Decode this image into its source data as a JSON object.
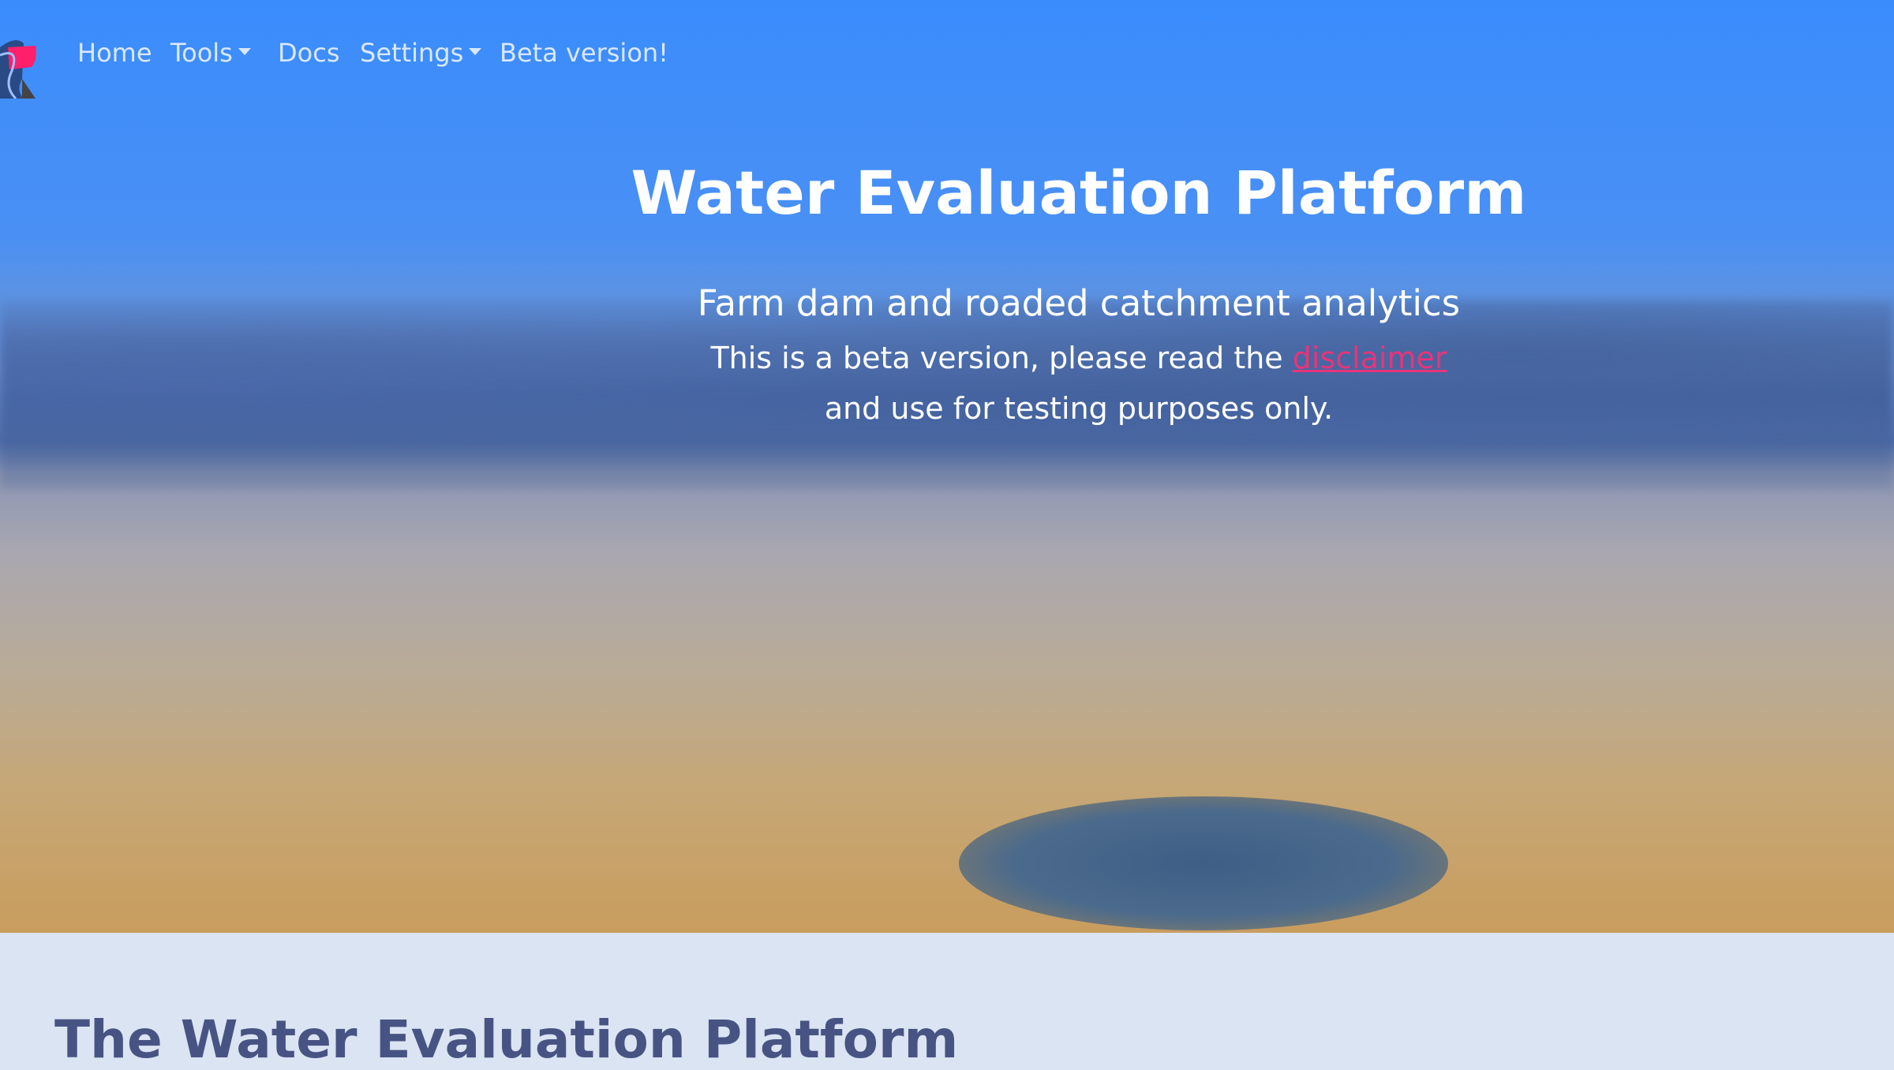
{
  "nav": {
    "items": [
      {
        "label": "Home"
      },
      {
        "label": "Tools",
        "dropdown": true
      },
      {
        "label": "Docs"
      },
      {
        "label": "Settings",
        "dropdown": true
      },
      {
        "label": "Beta version!"
      }
    ]
  },
  "hero": {
    "title": "Water Evaluation Platform",
    "subtitle": "Farm dam and roaded catchment analytics",
    "beta_prefix": "This is a beta version, please read the ",
    "beta_link": "disclaimer",
    "beta_suffix": "and use for testing purposes only."
  },
  "section": {
    "heading": "The Water Evaluation Platform"
  },
  "colors": {
    "nav_bg": "#3a8cfd",
    "link": "#e8347a",
    "heading": "#475483"
  }
}
